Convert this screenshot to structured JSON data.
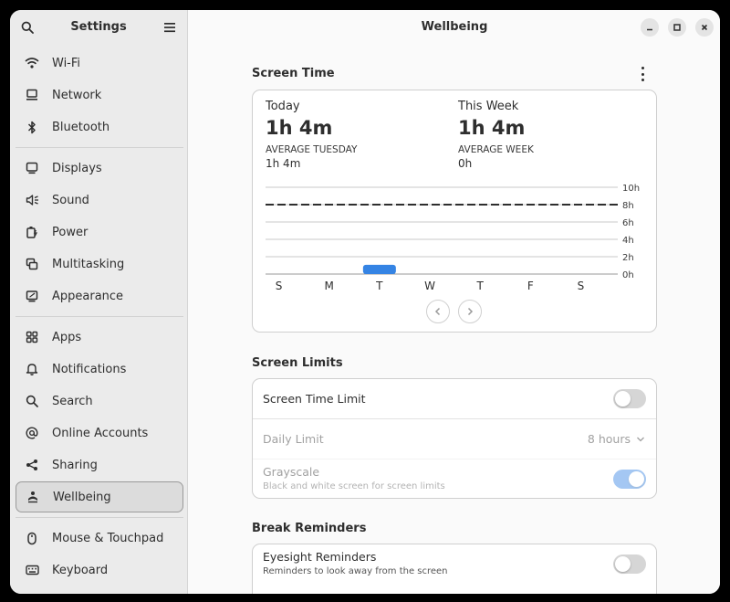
{
  "sidebar": {
    "title": "Settings",
    "items": [
      {
        "label": "Wi-Fi",
        "icon": "wifi-icon"
      },
      {
        "label": "Network",
        "icon": "network-icon"
      },
      {
        "label": "Bluetooth",
        "icon": "bluetooth-icon"
      },
      {
        "label": "Displays",
        "icon": "display-icon"
      },
      {
        "label": "Sound",
        "icon": "sound-icon"
      },
      {
        "label": "Power",
        "icon": "power-icon"
      },
      {
        "label": "Multitasking",
        "icon": "multitasking-icon"
      },
      {
        "label": "Appearance",
        "icon": "appearance-icon"
      },
      {
        "label": "Apps",
        "icon": "apps-icon"
      },
      {
        "label": "Notifications",
        "icon": "bell-icon"
      },
      {
        "label": "Search",
        "icon": "search-icon"
      },
      {
        "label": "Online Accounts",
        "icon": "at-icon"
      },
      {
        "label": "Sharing",
        "icon": "share-icon"
      },
      {
        "label": "Wellbeing",
        "icon": "wellbeing-icon",
        "active": true
      },
      {
        "label": "Mouse & Touchpad",
        "icon": "mouse-icon"
      },
      {
        "label": "Keyboard",
        "icon": "keyboard-icon"
      }
    ]
  },
  "main": {
    "title": "Wellbeing",
    "screen_time": {
      "heading": "Screen Time",
      "today": {
        "label": "Today",
        "value": "1h 4m",
        "avg_label": "AVERAGE TUESDAY",
        "avg_value": "1h 4m"
      },
      "week": {
        "label": "This Week",
        "value": "1h 4m",
        "avg_label": "AVERAGE WEEK",
        "avg_value": "0h"
      }
    },
    "screen_limits": {
      "heading": "Screen Limits",
      "time_limit_label": "Screen Time Limit",
      "time_limit_on": false,
      "daily_limit_label": "Daily Limit",
      "daily_limit_value": "8 hours",
      "grayscale_label": "Grayscale",
      "grayscale_sub": "Black and white screen for screen limits",
      "grayscale_on": true
    },
    "break_reminders": {
      "heading": "Break Reminders",
      "eyesight_label": "Eyesight Reminders",
      "eyesight_sub": "Reminders to look away from the screen",
      "eyesight_on": false
    }
  },
  "colors": {
    "accent": "#3584e4",
    "bar": "#3584e4"
  },
  "chart_data": {
    "type": "bar",
    "categories": [
      "S",
      "M",
      "T",
      "W",
      "T",
      "F",
      "S"
    ],
    "values": [
      0,
      0,
      1.07,
      0,
      0,
      0,
      0
    ],
    "y_ticks": [
      "0h",
      "2h",
      "4h",
      "6h",
      "8h",
      "10h"
    ],
    "ylim": [
      0,
      10
    ],
    "limit_line": 8,
    "grid": true
  }
}
